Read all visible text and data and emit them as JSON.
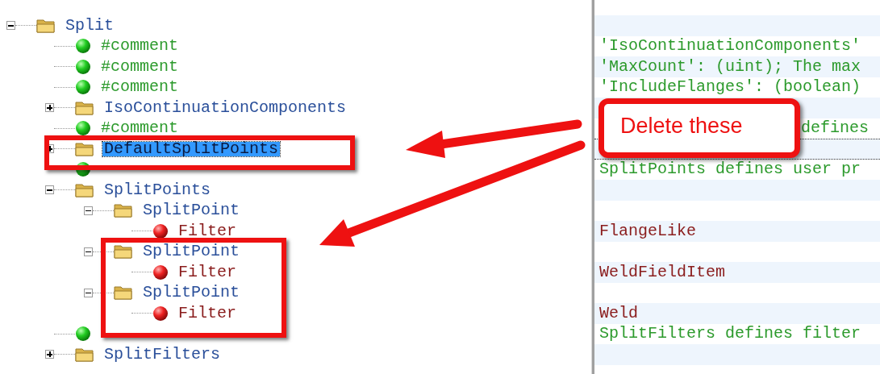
{
  "tree": [
    {
      "label": "Split",
      "kind": "folder",
      "expanded": true,
      "selected": false,
      "children": [
        {
          "label": "#comment",
          "kind": "comment",
          "selected": false
        },
        {
          "label": "#comment",
          "kind": "comment",
          "selected": false
        },
        {
          "label": "#comment",
          "kind": "comment",
          "selected": false
        },
        {
          "label": "IsoContinuationComponents",
          "kind": "folder",
          "expanded": false,
          "selected": false
        },
        {
          "label": "#comment",
          "kind": "comment",
          "selected": false
        },
        {
          "label": "DefaultSplitPoints",
          "kind": "folder",
          "expanded": false,
          "selected": true
        },
        {
          "kind": "comment"
        },
        {
          "label": "SplitPoints",
          "kind": "folder",
          "expanded": true,
          "selected": false,
          "children": [
            {
              "label": "SplitPoint",
              "kind": "folder",
              "expanded": true,
              "selected": false,
              "children": [
                {
                  "label": "Filter",
                  "kind": "element",
                  "selected": false
                }
              ]
            },
            {
              "label": "SplitPoint",
              "kind": "folder",
              "expanded": true,
              "selected": false,
              "children": [
                {
                  "label": "Filter",
                  "kind": "element",
                  "selected": false
                }
              ]
            },
            {
              "label": "SplitPoint",
              "kind": "folder",
              "expanded": true,
              "selected": false,
              "children": [
                {
                  "label": "Filter",
                  "kind": "element",
                  "selected": false
                }
              ]
            }
          ]
        },
        {
          "kind": "comment"
        },
        {
          "label": "SplitFilters",
          "kind": "folder",
          "expanded": false,
          "selected": false
        }
      ]
    }
  ],
  "values": [
    {
      "kind": "blank"
    },
    {
      "kind": "comment",
      "text": "'IsoContinuationComponents'"
    },
    {
      "kind": "comment",
      "text": "'MaxCount': (uint); The max"
    },
    {
      "kind": "comment",
      "text": "'IncludeFlanges': (boolean)"
    },
    {
      "kind": "blank"
    },
    {
      "kind": "comment_tail",
      "text": "defines"
    },
    {
      "kind": "blank",
      "focused": true
    },
    {
      "kind": "comment",
      "text": "SplitPoints defines user pr"
    },
    {
      "kind": "blank"
    },
    {
      "kind": "blank"
    },
    {
      "kind": "value",
      "text": "FlangeLike"
    },
    {
      "kind": "blank"
    },
    {
      "kind": "value",
      "text": "WeldFieldItem"
    },
    {
      "kind": "blank"
    },
    {
      "kind": "value",
      "text": "Weld"
    },
    {
      "kind": "comment",
      "text": "SplitFilters defines filter"
    },
    {
      "kind": "blank"
    }
  ],
  "callout": {
    "text": "Delete these"
  }
}
